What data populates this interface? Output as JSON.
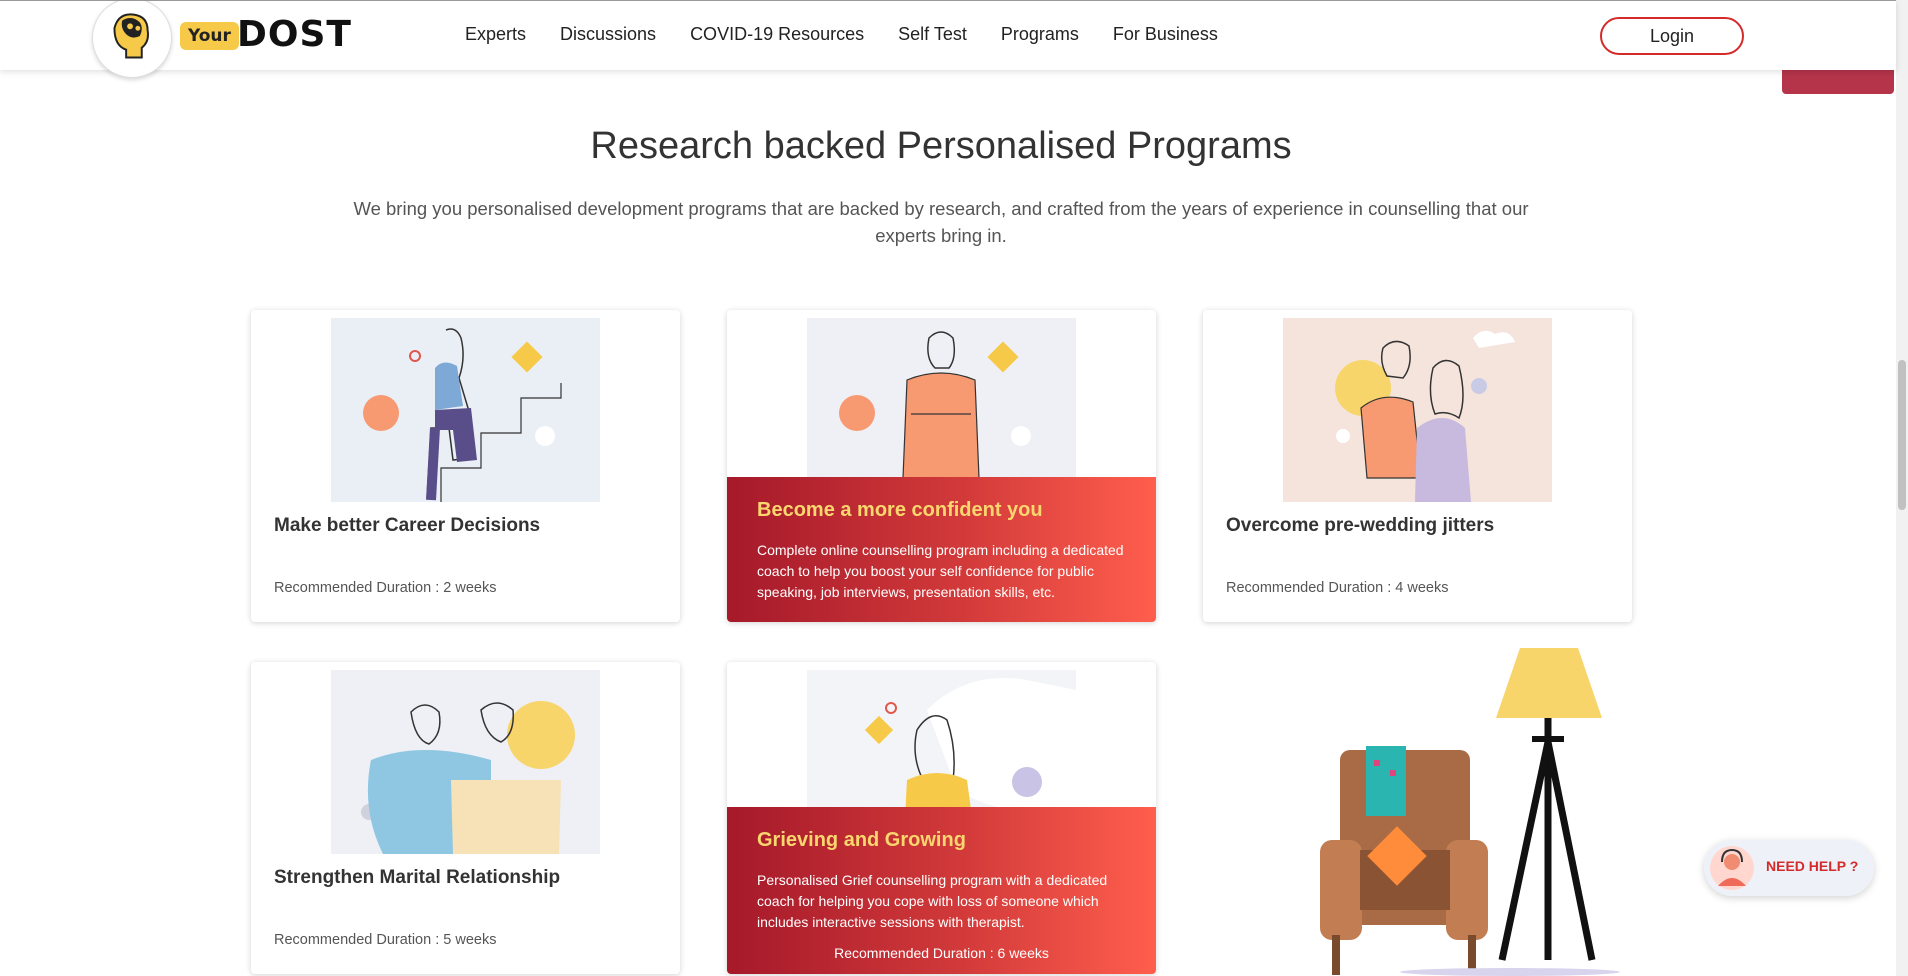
{
  "header": {
    "logo_your": "Your",
    "logo_dost": "DOST",
    "nav": [
      "Experts",
      "Discussions",
      "COVID-19 Resources",
      "Self Test",
      "Programs",
      "For Business"
    ],
    "login_label": "Login"
  },
  "section": {
    "title": "Research backed Personalised Programs",
    "subtitle": "We bring you personalised development programs that are backed by research, and crafted from the years of experience in counselling that our experts bring in."
  },
  "cards": [
    {
      "title": "Make better Career Decisions",
      "duration": "Recommended Duration : 2 weeks"
    },
    {
      "overlay_title": "Become a more confident you",
      "overlay_desc": "Complete online counselling program including a dedicated coach to help you boost your self confidence for public speaking, job interviews, presentation skills, etc."
    },
    {
      "title": "Overcome pre-wedding jitters",
      "duration": "Recommended Duration : 4 weeks"
    },
    {
      "title": "Strengthen Marital Relationship",
      "duration": "Recommended Duration : 5 weeks"
    },
    {
      "overlay_title": "Grieving and Growing",
      "overlay_desc": "Personalised Grief counselling program with a dedicated coach for helping you cope with loss of someone which includes interactive sessions with therapist.",
      "overlay_duration": "Recommended Duration : 6 weeks"
    }
  ],
  "need_help": {
    "label": "NEED HELP ?"
  },
  "colors": {
    "accent": "#d42a2a",
    "overlay_title": "#f9d66e",
    "logo_yellow": "#f7c948"
  }
}
